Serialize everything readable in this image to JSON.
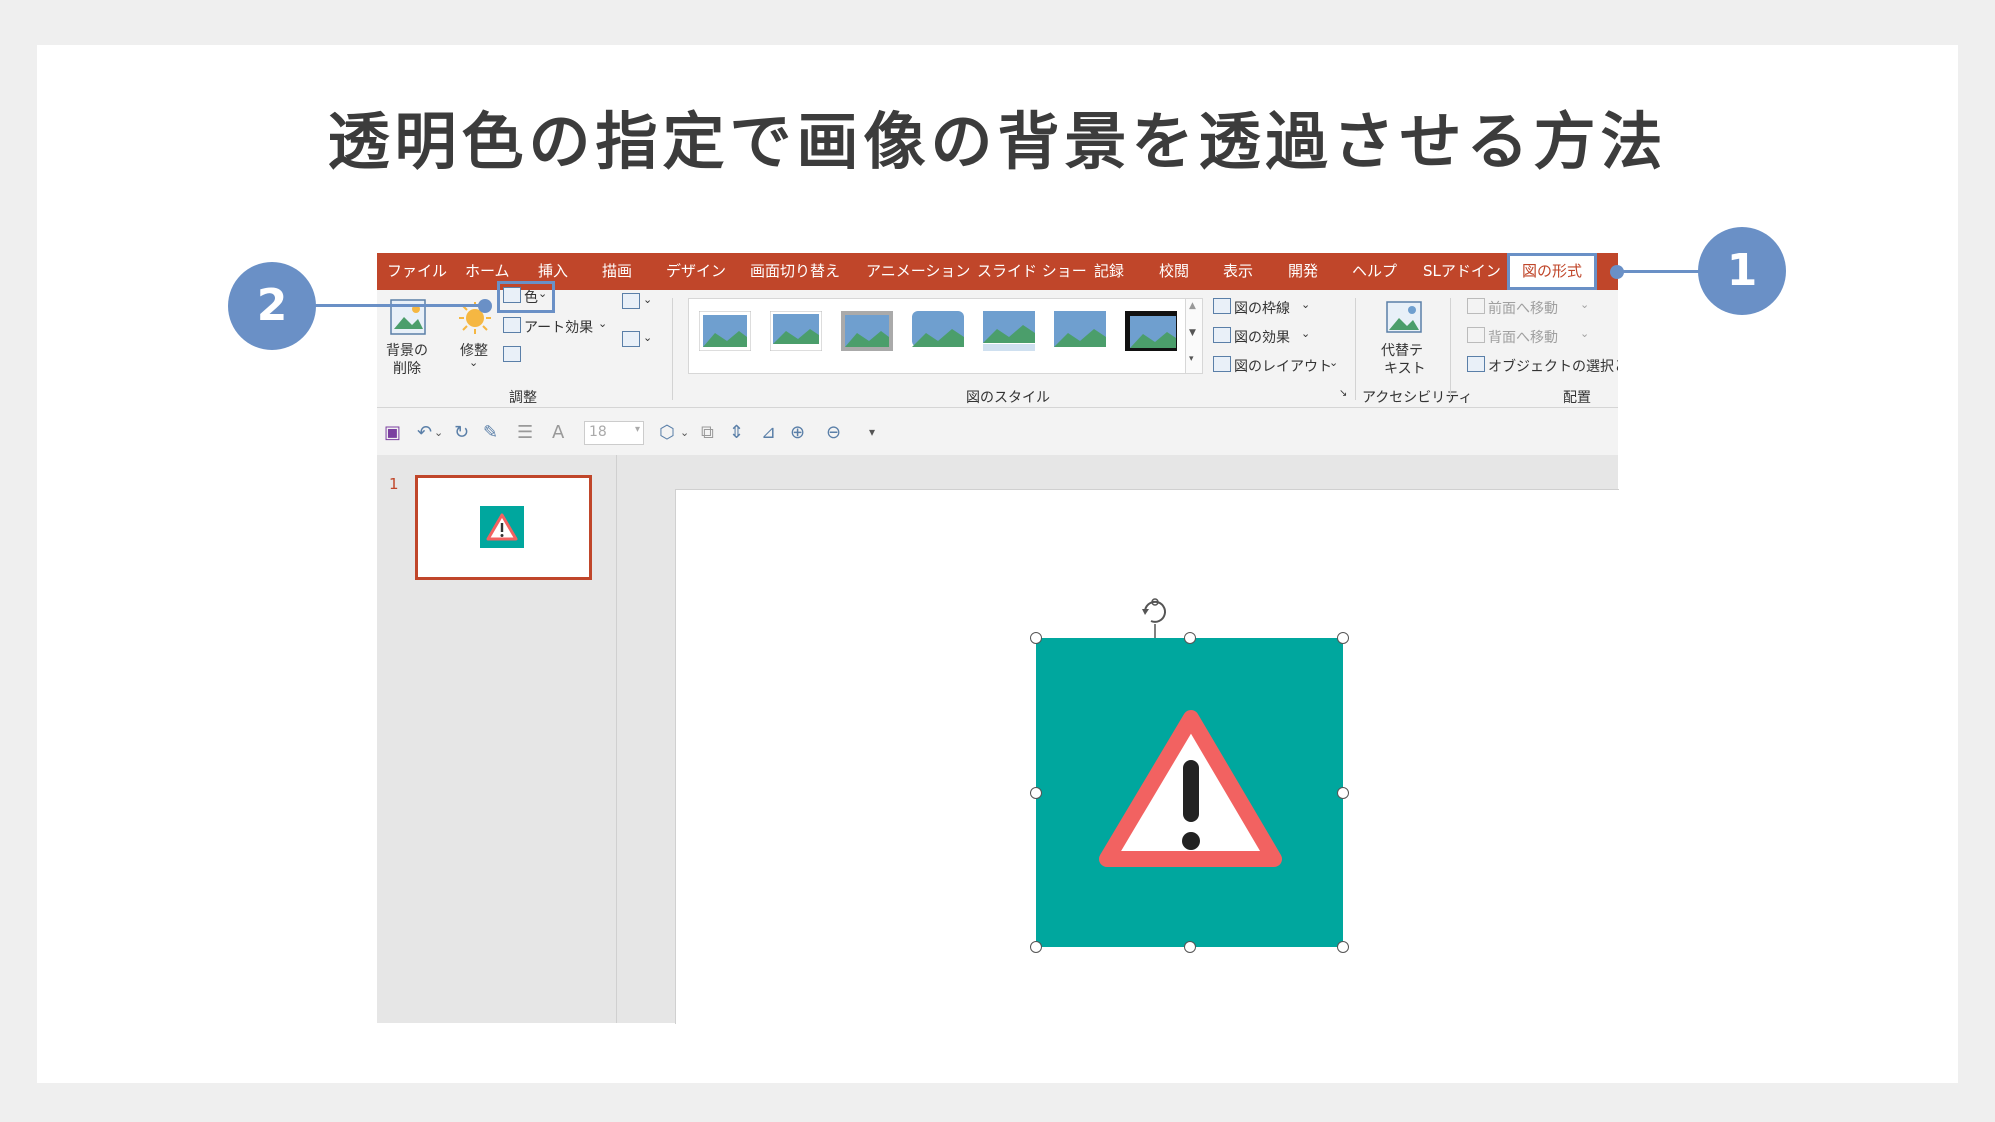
{
  "page": {
    "title": "透明色の指定で画像の背景を透過させる方法"
  },
  "ribbon_tabs": [
    {
      "label": "ファイル"
    },
    {
      "label": "ホーム"
    },
    {
      "label": "挿入"
    },
    {
      "label": "描画"
    },
    {
      "label": "デザイン"
    },
    {
      "label": "画面切り替え"
    },
    {
      "label": "アニメーション"
    },
    {
      "label": "スライド ショー"
    },
    {
      "label": "記録"
    },
    {
      "label": "校閲"
    },
    {
      "label": "表示"
    },
    {
      "label": "開発"
    },
    {
      "label": "ヘルプ"
    },
    {
      "label": "SLアドイン"
    },
    {
      "label": "図の形式"
    }
  ],
  "ribbon": {
    "remove_bg": "背景の\n削除",
    "remove_bg_line1": "背景の",
    "remove_bg_line2": "削除",
    "corrections": "修整",
    "color": "色",
    "artistic_effects": "アート効果",
    "adjust_group": "調整",
    "picture_styles_group": "図のスタイル",
    "picture_border": "図の枠線",
    "picture_effects": "図の効果",
    "picture_layout": "図のレイアウト",
    "alt_text_line1": "代替テ",
    "alt_text_line2": "キスト",
    "accessibility_group": "アクセシビリティ",
    "bring_forward": "前面へ移動",
    "send_backward": "背面へ移動",
    "selection_pane": "オブジェクトの選択と表",
    "arrange_group": "配置"
  },
  "qat": {
    "font_size": "18"
  },
  "thumbnails": [
    {
      "number": "1"
    }
  ],
  "callouts": {
    "first": "1",
    "second": "2"
  },
  "colors": {
    "accent": "#c0462a",
    "callout": "#6a90c6",
    "image_bg": "#00a79e",
    "warning_red": "#f26261"
  }
}
